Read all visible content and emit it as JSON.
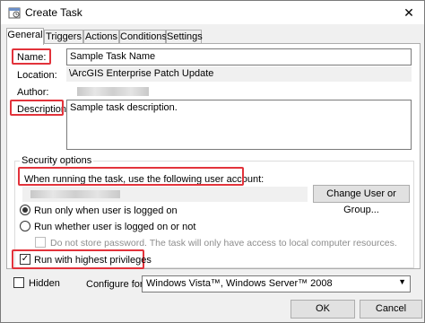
{
  "window": {
    "title": "Create Task",
    "close_symbol": "✕",
    "icon": "task-scheduler-icon"
  },
  "tabs": [
    {
      "label": "General",
      "active": true
    },
    {
      "label": "Triggers",
      "active": false
    },
    {
      "label": "Actions",
      "active": false
    },
    {
      "label": "Conditions",
      "active": false
    },
    {
      "label": "Settings",
      "active": false
    }
  ],
  "general": {
    "name_label": "Name:",
    "name_value": "Sample Task Name",
    "location_label": "Location:",
    "location_value": "\\ArcGIS Enterprise Patch Update",
    "author_label": "Author:",
    "description_label": "Description:",
    "description_value": "Sample task description."
  },
  "security": {
    "group_title": "Security options",
    "account_label": "When running the task, use the following user account:",
    "change_user_button": "Change User or Group...",
    "radio_logged_on": "Run only when user is logged on",
    "radio_logged_on_or_not": "Run whether user is logged on or not",
    "do_not_store_password": "Do not store password.  The task will only have access to local computer resources.",
    "run_highest_privileges": "Run with highest privileges",
    "check_mark": "✓"
  },
  "footer": {
    "hidden_label": "Hidden",
    "configure_for_label": "Configure for:",
    "configure_for_value": "Windows Vista™, Windows Server™ 2008",
    "ok_button": "OK",
    "cancel_button": "Cancel",
    "dropdown_arrow": "▼"
  },
  "colors": {
    "highlight_box": "#e2333b"
  }
}
